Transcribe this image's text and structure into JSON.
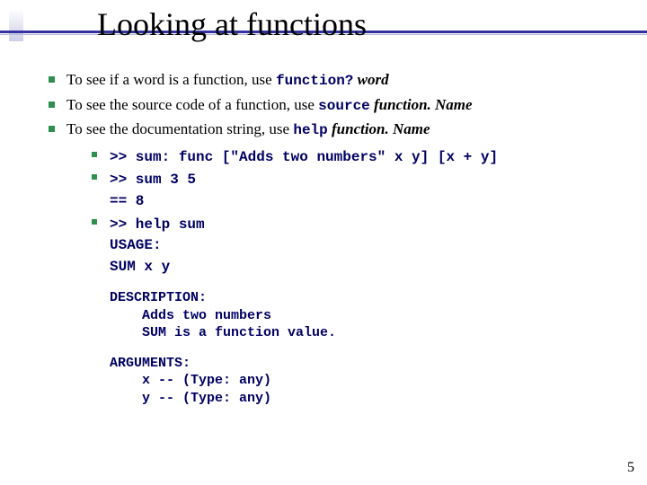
{
  "title": "Looking at functions",
  "bullets": {
    "b1_pre": "To see if a word is a function, use ",
    "b1_code": "function?",
    "b1_arg": " word",
    "b2_pre": "To see the source code of a function, use ",
    "b2_code": "source",
    "b2_arg": " function. Name",
    "b3_pre": "To see the documentation string, use ",
    "b3_code": "help",
    "b3_arg": " function. Name"
  },
  "sub": {
    "s1": ">> sum: func [\"Adds two numbers\" x y] [x + y]",
    "s2a": ">> sum 3 5",
    "s2b": "== 8",
    "s3a": ">> help sum",
    "s3b": "USAGE:",
    "s3c": "    SUM x y"
  },
  "codeblocks": {
    "desc": "DESCRIPTION:\n    Adds two numbers\n    SUM is a function value.",
    "args": "ARGUMENTS:\n    x -- (Type: any)\n    y -- (Type: any)"
  },
  "page_number": "5"
}
